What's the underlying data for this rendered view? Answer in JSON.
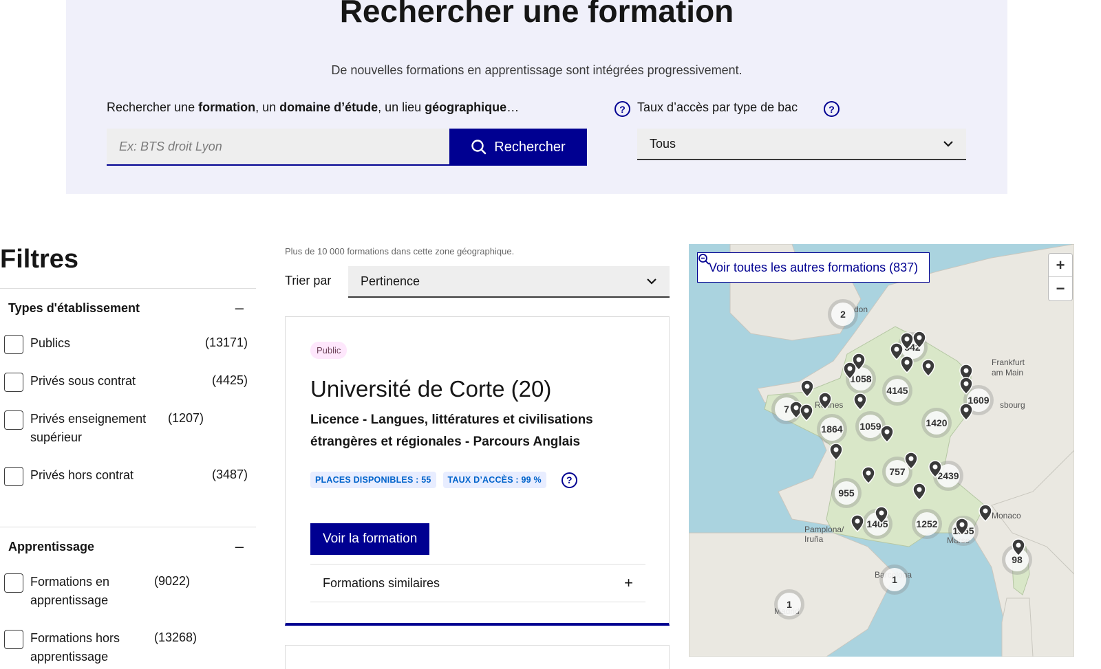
{
  "hero": {
    "title": "Rechercher une formation",
    "subtitle": "De nouvelles formations en apprentissage sont intégrées progressivement.",
    "search_label_1": "Rechercher une ",
    "search_label_b1": "formation",
    "search_label_2": ", un ",
    "search_label_b2": "domaine d’étude",
    "search_label_3": ", un lieu ",
    "search_label_b3": "géographique",
    "search_label_4": "…",
    "search_placeholder": "Ex: BTS droit Lyon",
    "search_button": "Rechercher",
    "bac_label": "Taux d’accès par type de bac",
    "bac_value": "Tous",
    "help_glyph": "?"
  },
  "filters": {
    "title": "Filtres",
    "groups": [
      {
        "title": "Types d'établissement",
        "toggle": "–",
        "items": [
          {
            "label": "Publics",
            "count": "(13171)"
          },
          {
            "label": "Privés sous contrat",
            "count": "(4425)"
          },
          {
            "label": "Privés enseignement supérieur",
            "count": "(1207)"
          },
          {
            "label": "Privés hors contrat",
            "count": "(3487)"
          }
        ]
      },
      {
        "title": "Apprentissage",
        "toggle": "–",
        "items": [
          {
            "label": "Formations en apprentissage",
            "count": "(9022)"
          },
          {
            "label": "Formations hors apprentissage",
            "count": "(13268)"
          }
        ]
      }
    ]
  },
  "results": {
    "count_text": "Plus de 10 000 formations dans cette zone géographique.",
    "sort_label": "Trier par",
    "sort_value": "Pertinence",
    "card": {
      "badge": "Public",
      "title": "Université de Corte (20)",
      "subtitle": "Licence - Langues, littératures et civilisations étrangères et régionales - Parcours Anglais",
      "tag_places": "PLACES DISPONIBLES : 55",
      "tag_taux": "TAUX D’ACCÈS : 99 %",
      "button": "Voir la formation",
      "similar_label": "Formations similaires",
      "similar_toggle": "+"
    }
  },
  "map": {
    "button": "Voir toutes les autres formations (837)",
    "zoom_in": "+",
    "zoom_out": "−",
    "clusters": [
      "2",
      "542",
      "1058",
      "4145",
      "1609",
      "7",
      "1864",
      "1059",
      "1420",
      "757",
      "2439",
      "955",
      "1405",
      "1252",
      "1365",
      "98",
      "1",
      "1"
    ],
    "labels": [
      "don",
      "Frankfurt am Main",
      "sbourg",
      "Pamplona/ Iruña",
      "Marse",
      "Barcelona",
      "Madrid",
      "Monaco",
      "Rennes"
    ]
  }
}
